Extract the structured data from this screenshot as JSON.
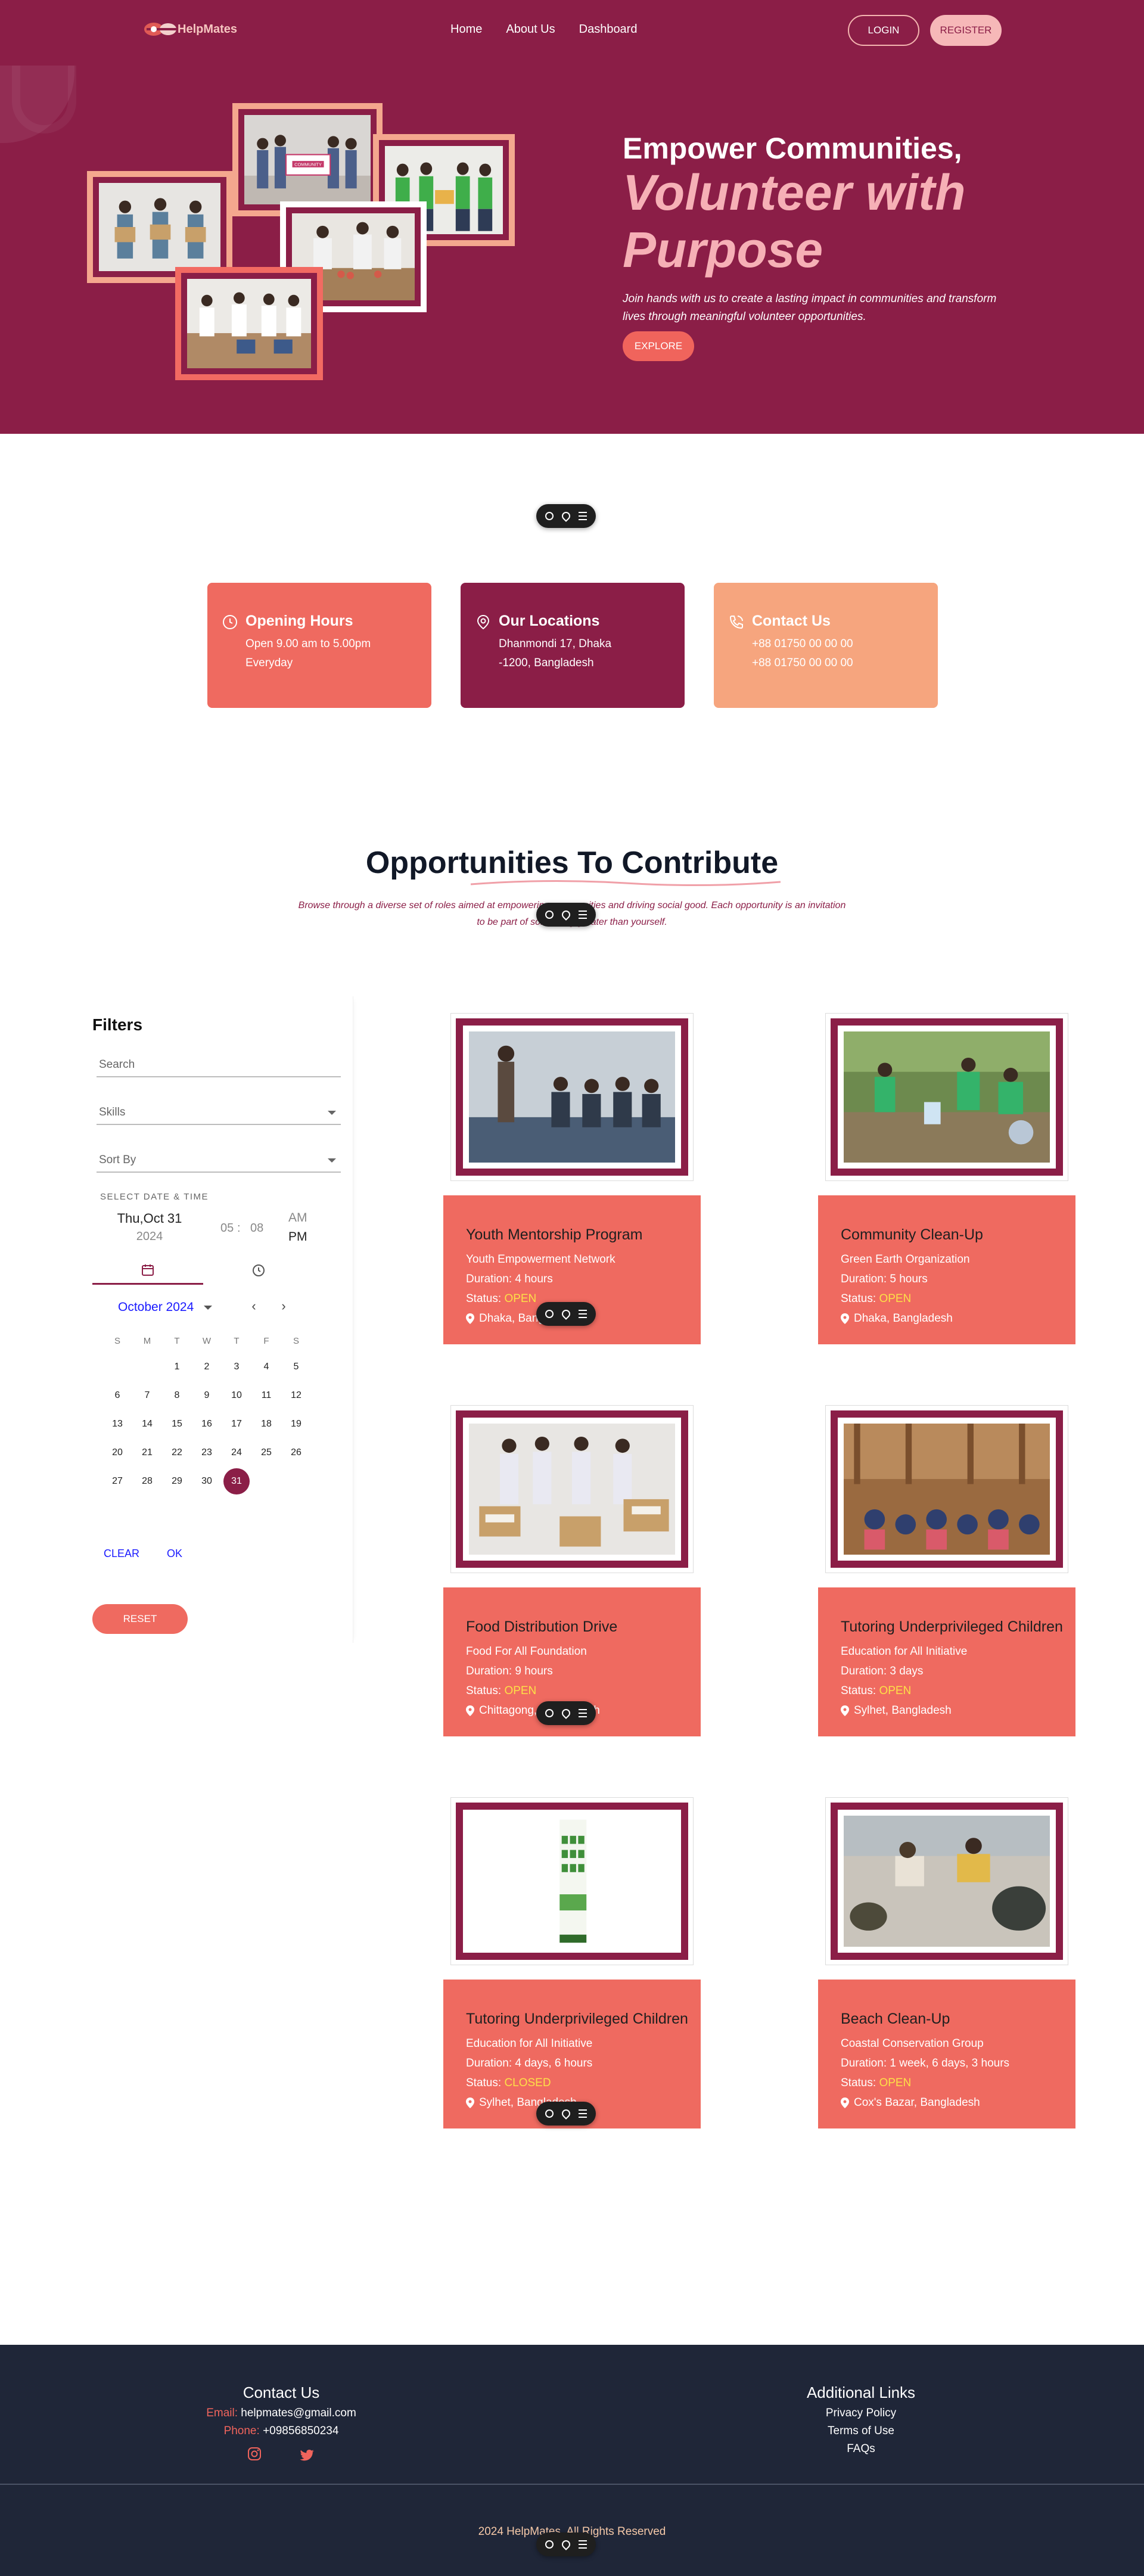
{
  "nav": {
    "logo_text": "HelpMates",
    "links": [
      "Home",
      "About Us",
      "Dashboard"
    ],
    "login_label": "LOGIN",
    "register_label": "REGISTER"
  },
  "hero": {
    "title": "Empower Communities,",
    "subtitle": "Volunteer with Purpose",
    "description": "Join hands with us to create a lasting impact in communities and transform lives through meaningful volunteer opportunities.",
    "explore_label": "EXPLORE",
    "photo_sign_text": "COMMUNITY"
  },
  "info_cards": [
    {
      "title": "Opening Hours",
      "lines": [
        "Open 9.00 am to 5.00pm",
        "Everyday"
      ],
      "color": "#ef6a60",
      "icon": "clock-icon"
    },
    {
      "title": "Our Locations",
      "lines": [
        "Dhanmondi 17, Dhaka",
        "-1200, Bangladesh"
      ],
      "color": "#8b1e47",
      "icon": "location-pin-icon"
    },
    {
      "title": "Contact Us",
      "lines": [
        "+88 01750 00 00 00",
        "+88 01750 00 00 00"
      ],
      "color": "#f6a57e",
      "icon": "phone-icon"
    }
  ],
  "opportunities": {
    "title": "Opportunities To Contribute",
    "description": "Browse through a diverse set of roles aimed at empowering communities and driving social good. Each opportunity is an invitation to be part of something greater than yourself."
  },
  "filters": {
    "title": "Filters",
    "search_placeholder": "Search",
    "skills_label": "Skills",
    "sort_label": "Sort By",
    "datetime_label": "SELECT DATE & TIME",
    "date_display": "Thu,Oct 31",
    "year_display": "2024",
    "hour": "05",
    "minute": "08",
    "am_label": "AM",
    "pm_label": "PM",
    "month_label": "October 2024",
    "weekdays": [
      "S",
      "M",
      "T",
      "W",
      "T",
      "F",
      "S"
    ],
    "selected_day": 31,
    "clear_label": "CLEAR",
    "ok_label": "OK",
    "reset_label": "RESET"
  },
  "cards": [
    {
      "name": "Youth Mentorship Program",
      "org": "Youth Empowerment Network",
      "duration": "Duration: 4 hours",
      "status_label": "Status:",
      "status": "OPEN",
      "location": "Dhaka, Bangladesh"
    },
    {
      "name": "Community Clean-Up",
      "org": "Green Earth Organization",
      "duration": "Duration: 5 hours",
      "status_label": "Status:",
      "status": "OPEN",
      "location": "Dhaka, Bangladesh"
    },
    {
      "name": "Food Distribution Drive",
      "org": "Food For All Foundation",
      "duration": "Duration: 9 hours",
      "status_label": "Status:",
      "status": "OPEN",
      "location": "Chittagong, Bangladesh"
    },
    {
      "name": "Tutoring Underprivileged Children",
      "org": "Education for All Initiative",
      "duration": "Duration: 3 days",
      "status_label": "Status:",
      "status": "OPEN",
      "location": "Sylhet, Bangladesh"
    },
    {
      "name": "Tutoring Underprivileged Children",
      "org": "Education for All Initiative",
      "duration": "Duration: 4 days, 6 hours",
      "status_label": "Status:",
      "status": "CLOSED",
      "location": "Sylhet, Bangladesh"
    },
    {
      "name": "Beach Clean-Up",
      "org": "Coastal Conservation Group",
      "duration": "Duration: 1 week, 6 days, 3 hours",
      "status_label": "Status:",
      "status": "OPEN",
      "location": "Cox's Bazar, Bangladesh"
    }
  ],
  "footer": {
    "contact_title": "Contact Us",
    "email_key": "Email:",
    "email_value": "helpmates@gmail.com",
    "phone_key": "Phone:",
    "phone_value": "+09856850234",
    "links_title": "Additional Links",
    "links": [
      "Privacy Policy",
      "Terms of Use",
      "FAQs"
    ],
    "copyright": "2024 HelpMates. All Rights Reserved"
  },
  "colors": {
    "brand": "#8b1e47",
    "accent": "#ef6a60",
    "peach": "#f6a57e",
    "status_open": "#fde047"
  }
}
